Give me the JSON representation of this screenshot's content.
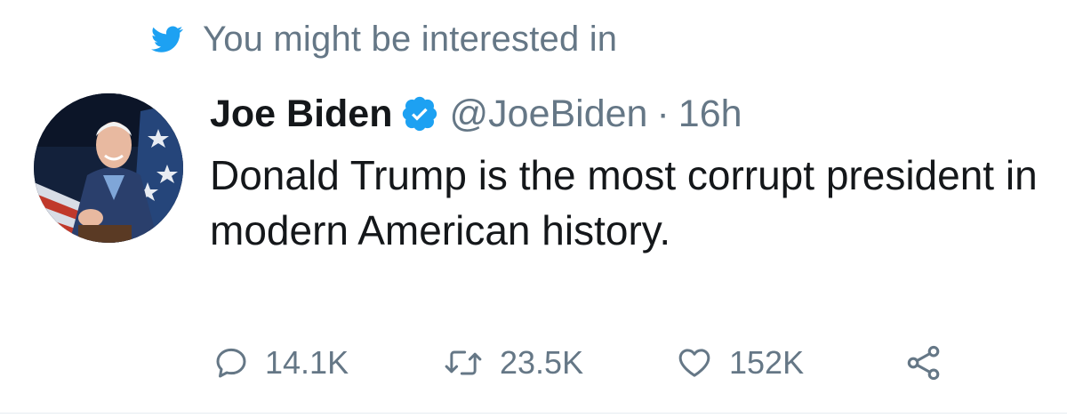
{
  "context": {
    "label": "You might be interested in",
    "icon": "twitter-bird-icon",
    "icon_color": "#1da1f2"
  },
  "tweet": {
    "author_name": "Joe Biden",
    "verified": true,
    "verified_icon": "verified-badge-icon",
    "verified_color": "#1da1f2",
    "handle": "@JoeBiden",
    "separator": "·",
    "time": "16h",
    "text": "Donald Trump is the most corrupt president in modern American history."
  },
  "actions": {
    "reply": {
      "icon": "reply-icon",
      "count": "14.1K"
    },
    "retweet": {
      "icon": "retweet-icon",
      "count": "23.5K"
    },
    "like": {
      "icon": "heart-icon",
      "count": "152K"
    },
    "share": {
      "icon": "share-icon"
    }
  },
  "colors": {
    "text_primary": "#14171a",
    "text_secondary": "#657786",
    "accent": "#1da1f2"
  }
}
